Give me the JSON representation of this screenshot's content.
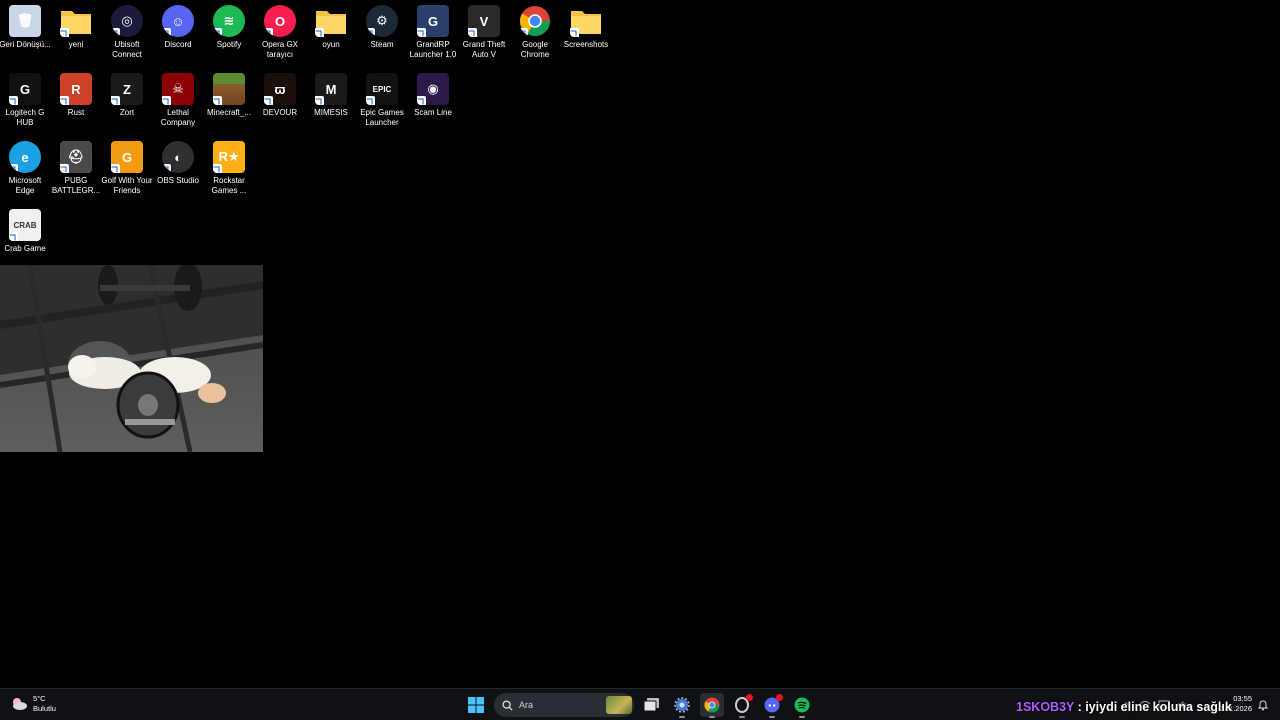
{
  "desktop": {
    "icons": [
      {
        "label": "Geri Dönüşü...",
        "icon": "recycle-bin-icon",
        "color": "#c8d6e5"
      },
      {
        "label": "yeni",
        "icon": "folder-icon",
        "color": "#f5c242"
      },
      {
        "label": "Ubisoft Connect",
        "icon": "ubisoft-icon",
        "color": "#1c1c3a"
      },
      {
        "label": "Discord",
        "icon": "discord-icon",
        "color": "#5865f2"
      },
      {
        "label": "Spotify",
        "icon": "spotify-icon",
        "color": "#1db954"
      },
      {
        "label": "Opera GX tarayıcı",
        "icon": "opera-gx-icon",
        "color": "#fa1e4e"
      },
      {
        "label": "oyun",
        "icon": "folder-icon",
        "color": "#f5c242"
      },
      {
        "label": "Steam",
        "icon": "steam-icon",
        "color": "#1b2838"
      },
      {
        "label": "GrandRP Launcher 1.0",
        "icon": "grandrp-icon",
        "color": "#2a3f6a"
      },
      {
        "label": "Grand Theft Auto V",
        "icon": "gta-v-icon",
        "color": "#2b2b2b"
      },
      {
        "label": "Google Chrome",
        "icon": "chrome-icon",
        "color": "#ea4335"
      },
      {
        "label": "Screenshots",
        "icon": "folder-icon",
        "color": "#f5c242"
      },
      {
        "label": "Logitech G HUB",
        "icon": "logitech-g-icon",
        "color": "#111111"
      },
      {
        "label": "Rust",
        "icon": "rust-icon",
        "color": "#cd412b"
      },
      {
        "label": "Zort",
        "icon": "zort-icon",
        "color": "#1a1a1a"
      },
      {
        "label": "Lethal Company",
        "icon": "lethal-company-icon",
        "color": "#8b0000"
      },
      {
        "label": "Minecraft_...",
        "icon": "minecraft-icon",
        "color": "#5b8c32"
      },
      {
        "label": "DEVOUR",
        "icon": "devour-icon",
        "color": "#1a0e0a"
      },
      {
        "label": "MIMESIS",
        "icon": "mimesis-icon",
        "color": "#1a1a1a"
      },
      {
        "label": "Epic Games Launcher",
        "icon": "epic-games-icon",
        "color": "#111111"
      },
      {
        "label": "Scam Line",
        "icon": "scam-line-icon",
        "color": "#2a1a4a"
      },
      {
        "label": "Microsoft Edge",
        "icon": "edge-icon",
        "color": "#1ba0e3"
      },
      {
        "label": "PUBG BATTLEGR...",
        "icon": "pubg-icon",
        "color": "#4a4a4a"
      },
      {
        "label": "Golf With Your Friends",
        "icon": "golf-icon",
        "color": "#f39c12"
      },
      {
        "label": "OBS Studio",
        "icon": "obs-icon",
        "color": "#302e31"
      },
      {
        "label": "Rockstar Games ...",
        "icon": "rockstar-icon",
        "color": "#fcaf17"
      },
      {
        "label": "Crab Game",
        "icon": "crab-game-icon",
        "color": "#f0f0f0"
      }
    ],
    "video_widget": {
      "name": "cat-dumbbell-video"
    }
  },
  "taskbar": {
    "weather": {
      "temp": "5°C",
      "condition": "Bulutlu"
    },
    "search": {
      "placeholder": "Ara"
    },
    "apps": [
      {
        "name": "start-button",
        "icon": "windows-icon"
      },
      {
        "name": "task-view-button",
        "icon": "task-view-icon"
      },
      {
        "name": "settings-app",
        "icon": "settings-icon"
      },
      {
        "name": "chrome-app",
        "icon": "chrome-icon"
      },
      {
        "name": "opera-gx-app",
        "icon": "opera-gx-icon"
      },
      {
        "name": "discord-app",
        "icon": "discord-icon"
      },
      {
        "name": "spotify-app",
        "icon": "spotify-icon"
      }
    ],
    "chat_overlay": {
      "user": "1SKOB3Y",
      "message": " : iyiydi eline koluna sağlık"
    },
    "clock": {
      "time": "03:55",
      "date": "0.01.2026"
    }
  }
}
